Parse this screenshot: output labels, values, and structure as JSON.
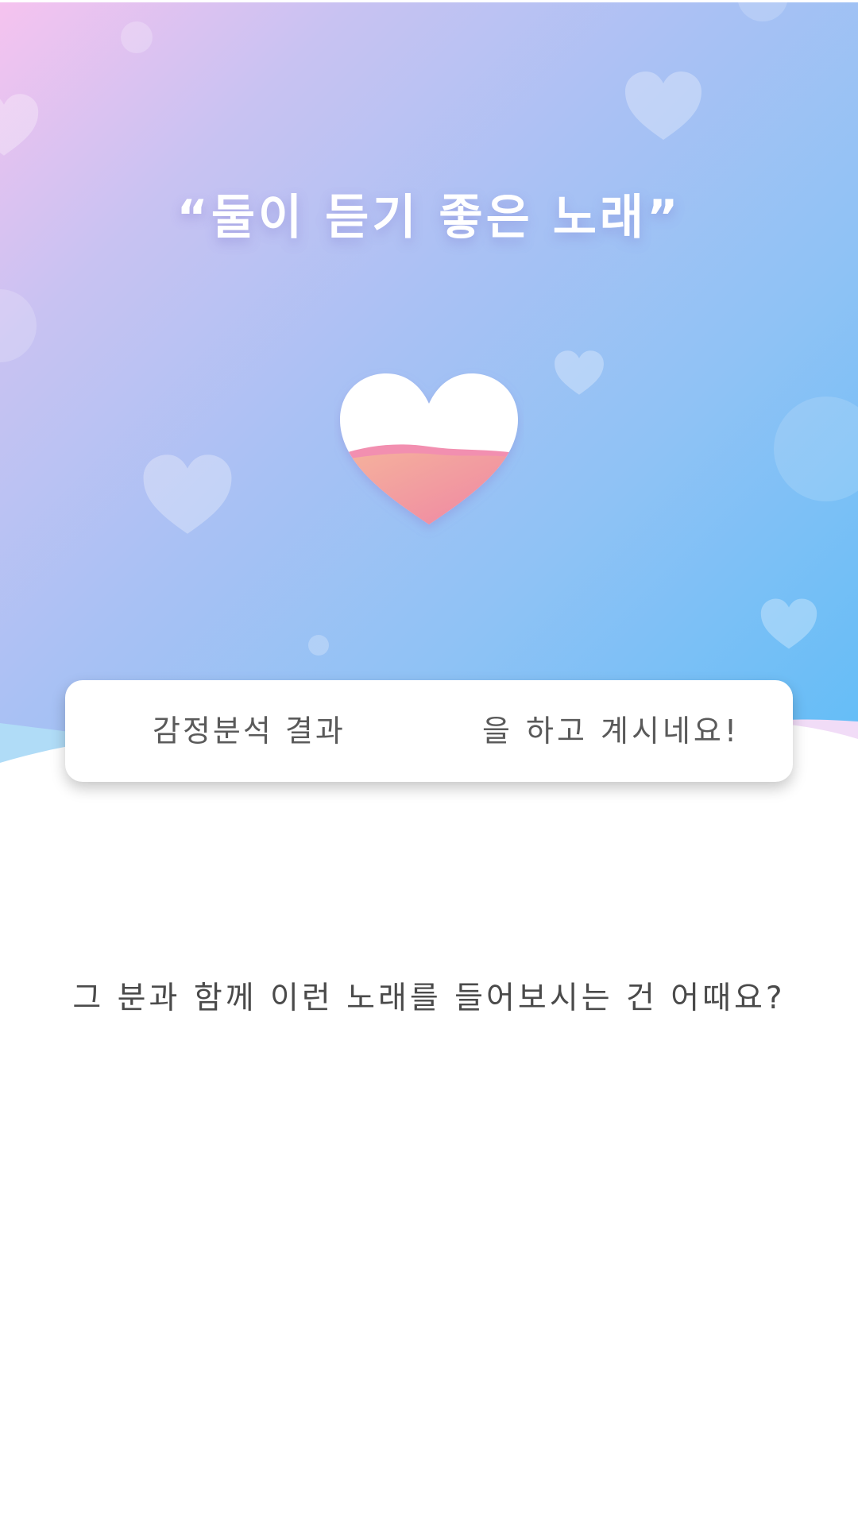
{
  "hero": {
    "title": "“둘이 듣기 좋은 노래”",
    "colors": {
      "gradient_start": "#f6c3ef",
      "gradient_mid": "#a9c1f4",
      "gradient_end": "#62bdf7",
      "heart_fill": "#f29aa6"
    },
    "main_icon": "heart-icon"
  },
  "result_card": {
    "left_label": "감정분석 결과",
    "right_label": "을 하고 계시네요!"
  },
  "recommendation": {
    "question": "그 분과 함께 이런 노래를 들어보시는 건 어때요?"
  }
}
